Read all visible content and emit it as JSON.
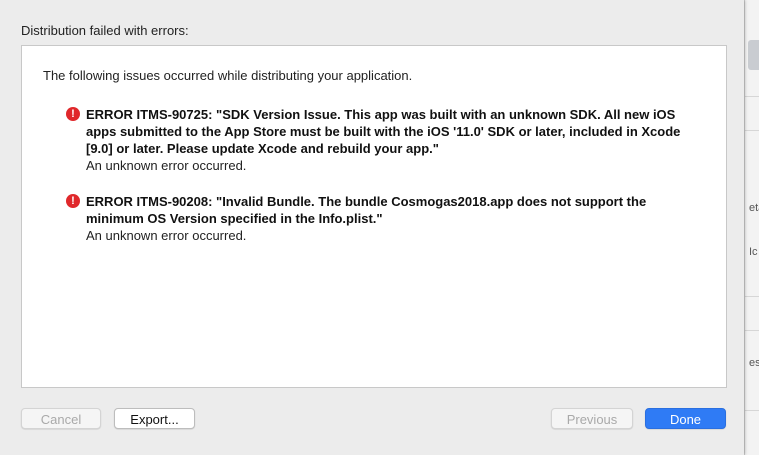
{
  "dialog": {
    "title": "Distribution failed with errors:",
    "intro": "The following issues occurred while distributing your application.",
    "issues": [
      {
        "message": "ERROR ITMS-90725: \"SDK Version Issue. This app was built with an unknown SDK. All new iOS apps submitted to the App Store must be built with the iOS '11.0' SDK or later, included in Xcode [9.0] or later. Please update Xcode and rebuild your app.\"",
        "detail": "An unknown error occurred.",
        "icon": "error-icon"
      },
      {
        "message": "ERROR ITMS-90208: \"Invalid Bundle. The bundle Cosmogas2018.app does not support the minimum OS Version specified in the Info.plist.\"",
        "detail": "An unknown error occurred.",
        "icon": "error-icon"
      }
    ]
  },
  "buttons": {
    "cancel": "Cancel",
    "export": "Export...",
    "previous": "Previous",
    "done": "Done"
  },
  "background_window": {
    "fragments": [
      "eta",
      "Ic",
      "es"
    ]
  },
  "colors": {
    "error_red": "#e0282b",
    "done_blue": "#2f7bf5"
  }
}
